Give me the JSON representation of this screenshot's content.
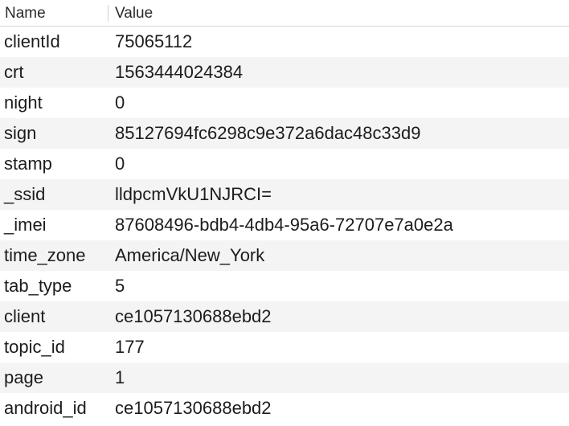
{
  "columns": {
    "name": "Name",
    "value": "Value"
  },
  "rows": [
    {
      "name": "clientId",
      "value": "75065112"
    },
    {
      "name": "crt",
      "value": "1563444024384"
    },
    {
      "name": "night",
      "value": "0"
    },
    {
      "name": "sign",
      "value": "85127694fc6298c9e372a6dac48c33d9"
    },
    {
      "name": "stamp",
      "value": "0"
    },
    {
      "name": "_ssid",
      "value": "lldpcmVkU1NJRCI="
    },
    {
      "name": "_imei",
      "value": "87608496-bdb4-4db4-95a6-72707e7a0e2a"
    },
    {
      "name": "time_zone",
      "value": "America/New_York"
    },
    {
      "name": "tab_type",
      "value": "5"
    },
    {
      "name": "client",
      "value": "ce1057130688ebd2"
    },
    {
      "name": "topic_id",
      "value": "177"
    },
    {
      "name": "page",
      "value": "1"
    },
    {
      "name": "android_id",
      "value": "ce1057130688ebd2"
    }
  ]
}
